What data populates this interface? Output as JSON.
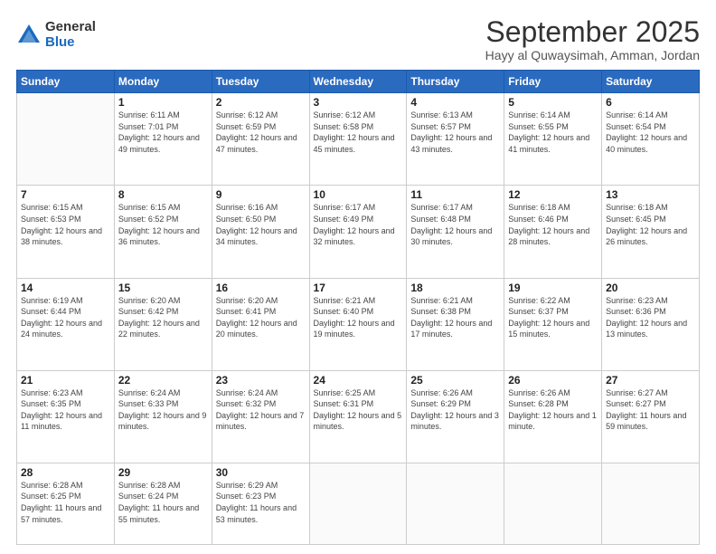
{
  "header": {
    "logo_general": "General",
    "logo_blue": "Blue",
    "month": "September 2025",
    "location": "Hayy al Quwaysimah, Amman, Jordan"
  },
  "days_of_week": [
    "Sunday",
    "Monday",
    "Tuesday",
    "Wednesday",
    "Thursday",
    "Friday",
    "Saturday"
  ],
  "weeks": [
    [
      {
        "day": "",
        "info": ""
      },
      {
        "day": "1",
        "info": "Sunrise: 6:11 AM\nSunset: 7:01 PM\nDaylight: 12 hours\nand 49 minutes."
      },
      {
        "day": "2",
        "info": "Sunrise: 6:12 AM\nSunset: 6:59 PM\nDaylight: 12 hours\nand 47 minutes."
      },
      {
        "day": "3",
        "info": "Sunrise: 6:12 AM\nSunset: 6:58 PM\nDaylight: 12 hours\nand 45 minutes."
      },
      {
        "day": "4",
        "info": "Sunrise: 6:13 AM\nSunset: 6:57 PM\nDaylight: 12 hours\nand 43 minutes."
      },
      {
        "day": "5",
        "info": "Sunrise: 6:14 AM\nSunset: 6:55 PM\nDaylight: 12 hours\nand 41 minutes."
      },
      {
        "day": "6",
        "info": "Sunrise: 6:14 AM\nSunset: 6:54 PM\nDaylight: 12 hours\nand 40 minutes."
      }
    ],
    [
      {
        "day": "7",
        "info": "Sunrise: 6:15 AM\nSunset: 6:53 PM\nDaylight: 12 hours\nand 38 minutes."
      },
      {
        "day": "8",
        "info": "Sunrise: 6:15 AM\nSunset: 6:52 PM\nDaylight: 12 hours\nand 36 minutes."
      },
      {
        "day": "9",
        "info": "Sunrise: 6:16 AM\nSunset: 6:50 PM\nDaylight: 12 hours\nand 34 minutes."
      },
      {
        "day": "10",
        "info": "Sunrise: 6:17 AM\nSunset: 6:49 PM\nDaylight: 12 hours\nand 32 minutes."
      },
      {
        "day": "11",
        "info": "Sunrise: 6:17 AM\nSunset: 6:48 PM\nDaylight: 12 hours\nand 30 minutes."
      },
      {
        "day": "12",
        "info": "Sunrise: 6:18 AM\nSunset: 6:46 PM\nDaylight: 12 hours\nand 28 minutes."
      },
      {
        "day": "13",
        "info": "Sunrise: 6:18 AM\nSunset: 6:45 PM\nDaylight: 12 hours\nand 26 minutes."
      }
    ],
    [
      {
        "day": "14",
        "info": "Sunrise: 6:19 AM\nSunset: 6:44 PM\nDaylight: 12 hours\nand 24 minutes."
      },
      {
        "day": "15",
        "info": "Sunrise: 6:20 AM\nSunset: 6:42 PM\nDaylight: 12 hours\nand 22 minutes."
      },
      {
        "day": "16",
        "info": "Sunrise: 6:20 AM\nSunset: 6:41 PM\nDaylight: 12 hours\nand 20 minutes."
      },
      {
        "day": "17",
        "info": "Sunrise: 6:21 AM\nSunset: 6:40 PM\nDaylight: 12 hours\nand 19 minutes."
      },
      {
        "day": "18",
        "info": "Sunrise: 6:21 AM\nSunset: 6:38 PM\nDaylight: 12 hours\nand 17 minutes."
      },
      {
        "day": "19",
        "info": "Sunrise: 6:22 AM\nSunset: 6:37 PM\nDaylight: 12 hours\nand 15 minutes."
      },
      {
        "day": "20",
        "info": "Sunrise: 6:23 AM\nSunset: 6:36 PM\nDaylight: 12 hours\nand 13 minutes."
      }
    ],
    [
      {
        "day": "21",
        "info": "Sunrise: 6:23 AM\nSunset: 6:35 PM\nDaylight: 12 hours\nand 11 minutes."
      },
      {
        "day": "22",
        "info": "Sunrise: 6:24 AM\nSunset: 6:33 PM\nDaylight: 12 hours\nand 9 minutes."
      },
      {
        "day": "23",
        "info": "Sunrise: 6:24 AM\nSunset: 6:32 PM\nDaylight: 12 hours\nand 7 minutes."
      },
      {
        "day": "24",
        "info": "Sunrise: 6:25 AM\nSunset: 6:31 PM\nDaylight: 12 hours\nand 5 minutes."
      },
      {
        "day": "25",
        "info": "Sunrise: 6:26 AM\nSunset: 6:29 PM\nDaylight: 12 hours\nand 3 minutes."
      },
      {
        "day": "26",
        "info": "Sunrise: 6:26 AM\nSunset: 6:28 PM\nDaylight: 12 hours\nand 1 minute."
      },
      {
        "day": "27",
        "info": "Sunrise: 6:27 AM\nSunset: 6:27 PM\nDaylight: 11 hours\nand 59 minutes."
      }
    ],
    [
      {
        "day": "28",
        "info": "Sunrise: 6:28 AM\nSunset: 6:25 PM\nDaylight: 11 hours\nand 57 minutes."
      },
      {
        "day": "29",
        "info": "Sunrise: 6:28 AM\nSunset: 6:24 PM\nDaylight: 11 hours\nand 55 minutes."
      },
      {
        "day": "30",
        "info": "Sunrise: 6:29 AM\nSunset: 6:23 PM\nDaylight: 11 hours\nand 53 minutes."
      },
      {
        "day": "",
        "info": ""
      },
      {
        "day": "",
        "info": ""
      },
      {
        "day": "",
        "info": ""
      },
      {
        "day": "",
        "info": ""
      }
    ]
  ]
}
